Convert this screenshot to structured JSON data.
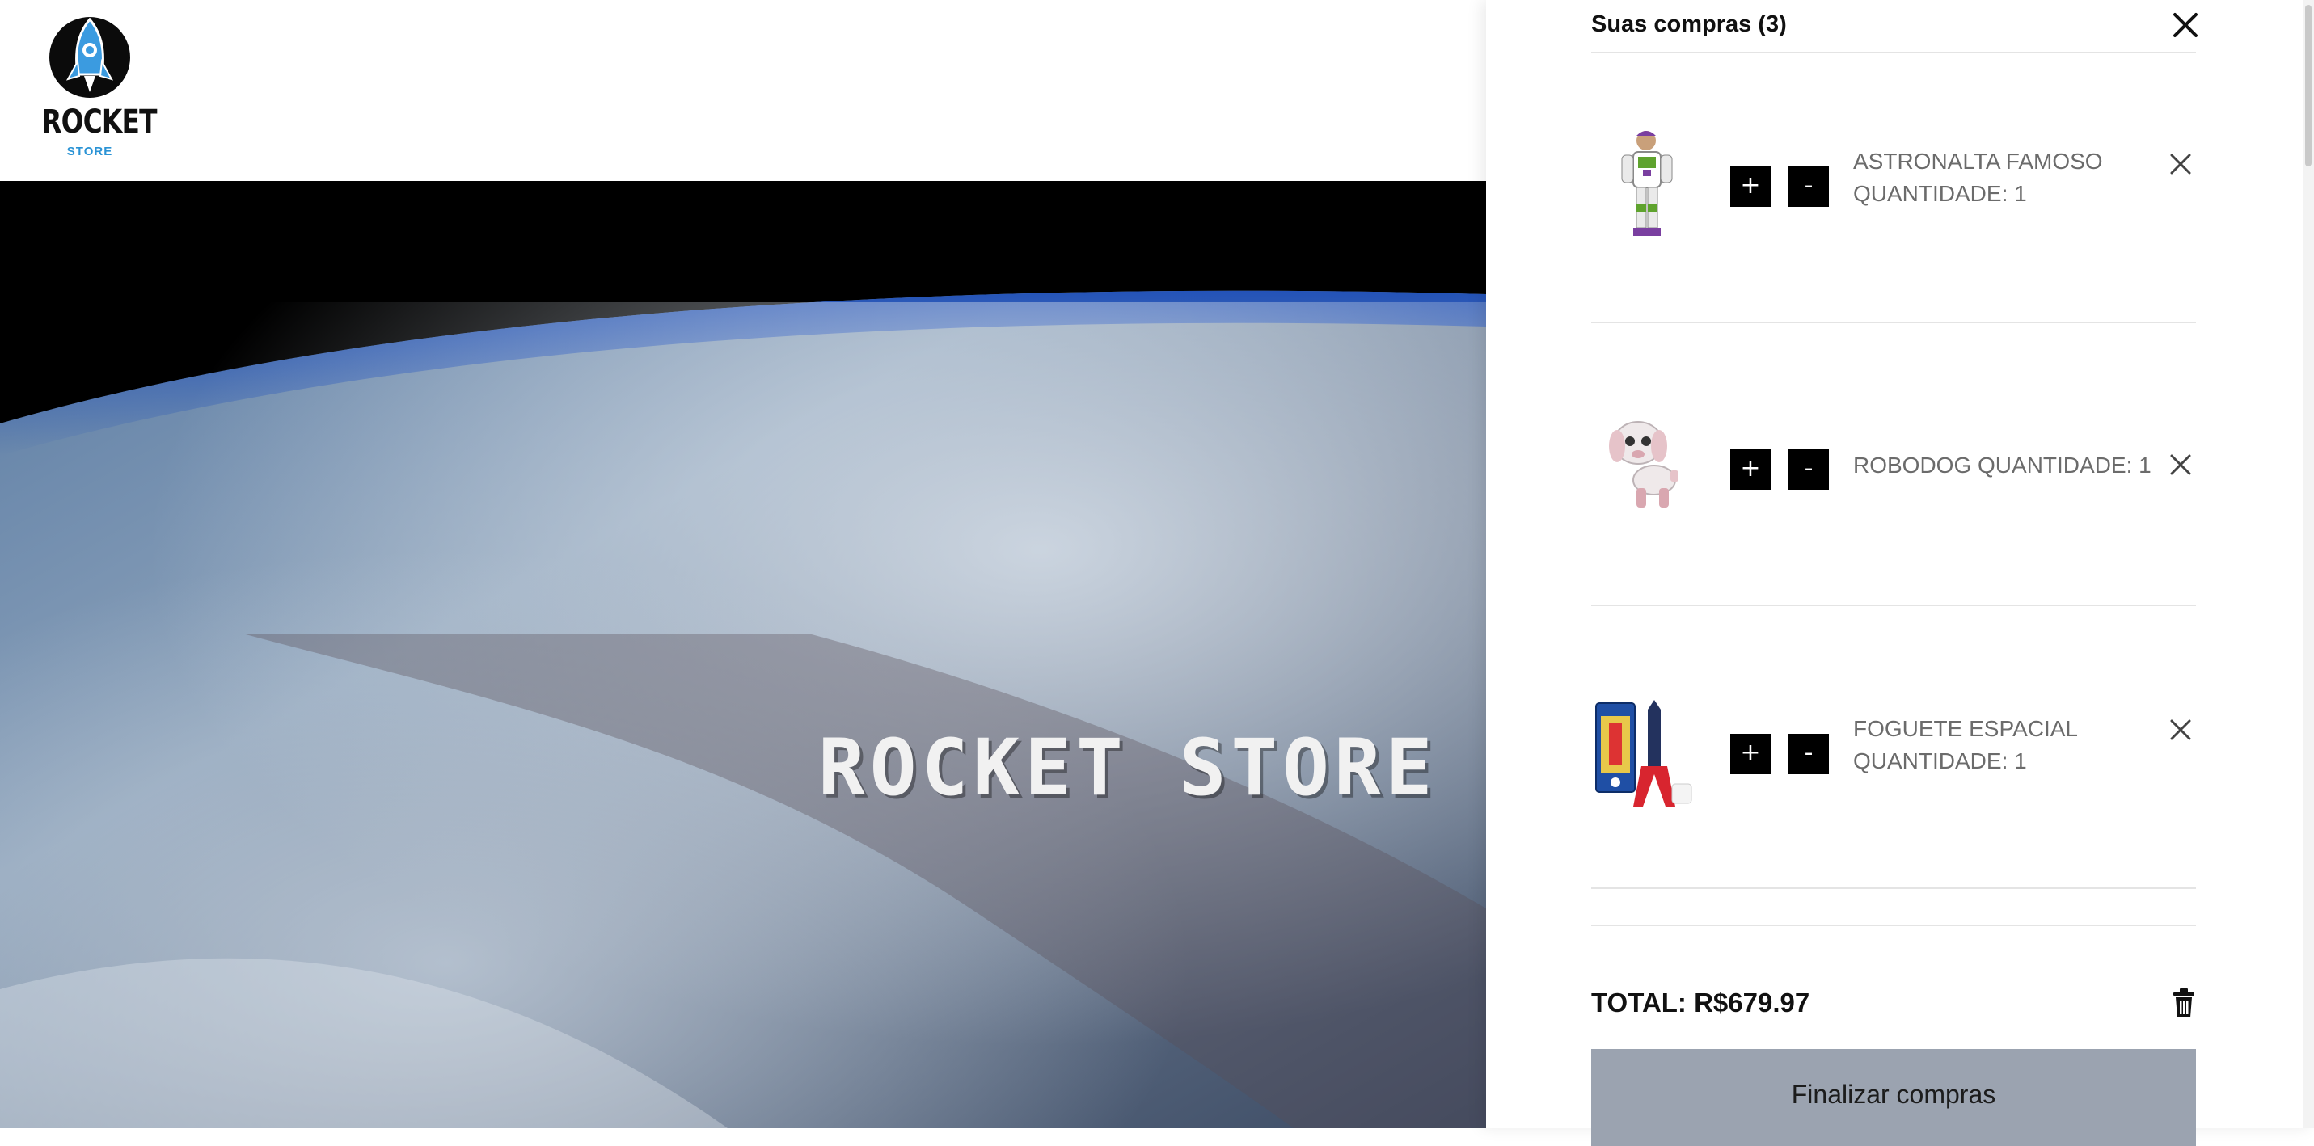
{
  "header": {
    "logo_text": "ROCKET",
    "logo_subtext": "STORE"
  },
  "hero": {
    "title": "ROCKET STORE ."
  },
  "cart": {
    "title": "Suas compras (3)",
    "items": [
      {
        "name_qty": "ASTRONALTA FAMOSO QUANTIDADE: 1",
        "plus": "+",
        "minus": "-",
        "thumb_icon": "buzz-lightyear-figure"
      },
      {
        "name_qty": "ROBODOG QUANTIDADE: 1",
        "plus": "+",
        "minus": "-",
        "thumb_icon": "robot-dog-toy"
      },
      {
        "name_qty": "FOGUETE ESPACIAL QUANTIDADE: 1",
        "plus": "+",
        "minus": "-",
        "thumb_icon": "rocket-toy-box"
      }
    ],
    "total": "TOTAL: R$679.97",
    "checkout_label": "Finalizar compras"
  },
  "colors": {
    "checkout_bg": "#9ba3b0",
    "logo_blue": "#2a93d5"
  }
}
